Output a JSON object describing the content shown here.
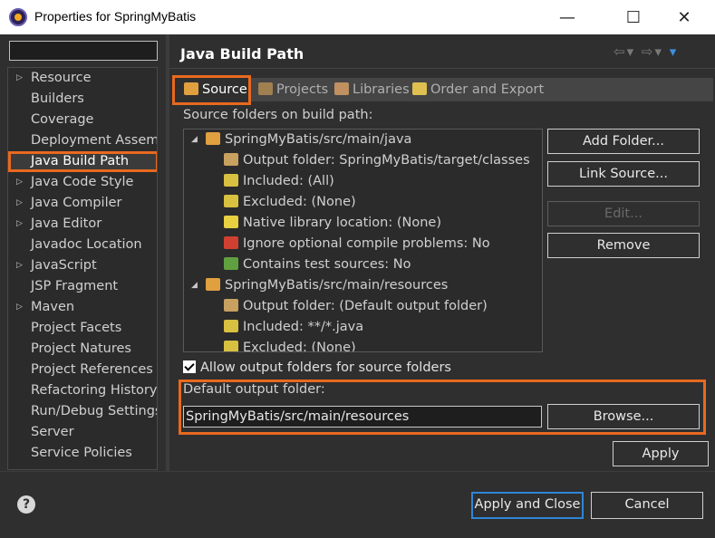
{
  "window": {
    "title": "Properties for SpringMyBatis",
    "minimize_glyph": "—",
    "maximize_glyph": "☐",
    "close_glyph": "✕"
  },
  "filter": {
    "value": "",
    "placeholder": ""
  },
  "nav": {
    "items": [
      {
        "label": "Resource",
        "expandable": true
      },
      {
        "label": "Builders",
        "expandable": false
      },
      {
        "label": "Coverage",
        "expandable": false
      },
      {
        "label": "Deployment Assembly",
        "expandable": false
      },
      {
        "label": "Java Build Path",
        "expandable": false,
        "selected": true
      },
      {
        "label": "Java Code Style",
        "expandable": true
      },
      {
        "label": "Java Compiler",
        "expandable": true
      },
      {
        "label": "Java Editor",
        "expandable": true
      },
      {
        "label": "Javadoc Location",
        "expandable": false
      },
      {
        "label": "JavaScript",
        "expandable": true
      },
      {
        "label": "JSP Fragment",
        "expandable": false
      },
      {
        "label": "Maven",
        "expandable": true
      },
      {
        "label": "Project Facets",
        "expandable": false
      },
      {
        "label": "Project Natures",
        "expandable": false
      },
      {
        "label": "Project References",
        "expandable": false
      },
      {
        "label": "Refactoring History",
        "expandable": false
      },
      {
        "label": "Run/Debug Settings",
        "expandable": false
      },
      {
        "label": "Server",
        "expandable": false
      },
      {
        "label": "Service Policies",
        "expandable": false
      }
    ]
  },
  "page": {
    "title": "Java Build Path",
    "nav_back": "⇦",
    "nav_forward": "⇨",
    "nav_dropdown": "▾",
    "view_menu": "▾"
  },
  "tabs": [
    {
      "label": "Source",
      "icon": "folder-source-icon",
      "active": true
    },
    {
      "label": "Projects",
      "icon": "folder-projects-icon",
      "active": false
    },
    {
      "label": "Libraries",
      "icon": "libraries-icon",
      "active": false
    },
    {
      "label": "Order and Export",
      "icon": "order-export-icon",
      "active": false
    }
  ],
  "source": {
    "label": "Source folders on build path:",
    "tree": [
      {
        "text": "SpringMyBatis/src/main/java",
        "level": 0,
        "icon": "package-folder-icon",
        "expanded": true
      },
      {
        "text": "Output folder: SpringMyBatis/target/classes",
        "level": 1,
        "icon": "output-folder-icon"
      },
      {
        "text": "Included: (All)",
        "level": 1,
        "icon": "included-icon"
      },
      {
        "text": "Excluded: (None)",
        "level": 1,
        "icon": "excluded-icon"
      },
      {
        "text": "Native library location: (None)",
        "level": 1,
        "icon": "native-library-icon"
      },
      {
        "text": "Ignore optional compile problems: No",
        "level": 1,
        "icon": "ignore-problems-icon"
      },
      {
        "text": "Contains test sources: No",
        "level": 1,
        "icon": "test-sources-icon"
      },
      {
        "text": "SpringMyBatis/src/main/resources",
        "level": 0,
        "icon": "package-folder-icon",
        "expanded": true
      },
      {
        "text": "Output folder: (Default output folder)",
        "level": 1,
        "icon": "output-folder-icon"
      },
      {
        "text": "Included: **/*.java",
        "level": 1,
        "icon": "included-icon"
      },
      {
        "text": "Excluded: (None)",
        "level": 1,
        "icon": "excluded-icon"
      }
    ],
    "expand_glyph": "◢"
  },
  "buttons": {
    "add_folder": "Add Folder...",
    "link_source": "Link Source...",
    "edit": "Edit...",
    "remove": "Remove",
    "browse": "Browse...",
    "apply": "Apply",
    "apply_close": "Apply and Close",
    "cancel": "Cancel"
  },
  "allow_output": {
    "label": "Allow output folders for source folders",
    "checked": true
  },
  "default_output": {
    "label": "Default output folder:",
    "value": "SpringMyBatis/src/main/resources"
  },
  "help": {
    "glyph": "?"
  },
  "colors": {
    "highlight": "#e8691f",
    "default_button_border": "#2f86d6",
    "background": "#2f2f2f"
  }
}
